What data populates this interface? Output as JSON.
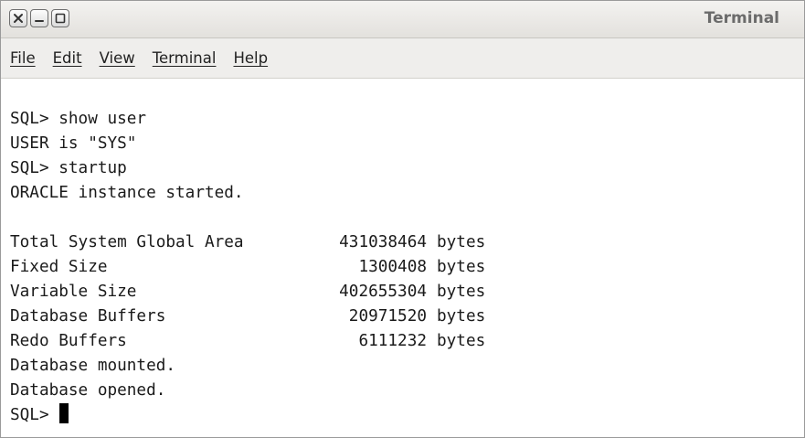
{
  "window": {
    "title": "Terminal",
    "buttons": [
      "close",
      "minimize",
      "maximize"
    ]
  },
  "menubar": {
    "items": [
      "File",
      "Edit",
      "View",
      "Terminal",
      "Help"
    ]
  },
  "terminal": {
    "lines_before": [
      "SQL> show user",
      "USER is \"SYS\"",
      "SQL> startup",
      "ORACLE instance started."
    ],
    "sga": [
      {
        "label": "Total System Global Area",
        "value": "431038464",
        "unit": "bytes"
      },
      {
        "label": "Fixed Size",
        "value": "1300408",
        "unit": "bytes"
      },
      {
        "label": "Variable Size",
        "value": "402655304",
        "unit": "bytes"
      },
      {
        "label": "Database Buffers",
        "value": "20971520",
        "unit": "bytes"
      },
      {
        "label": "Redo Buffers",
        "value": "6111232",
        "unit": "bytes"
      }
    ],
    "lines_after": [
      "Database mounted.",
      "Database opened."
    ],
    "prompt": "SQL>"
  }
}
